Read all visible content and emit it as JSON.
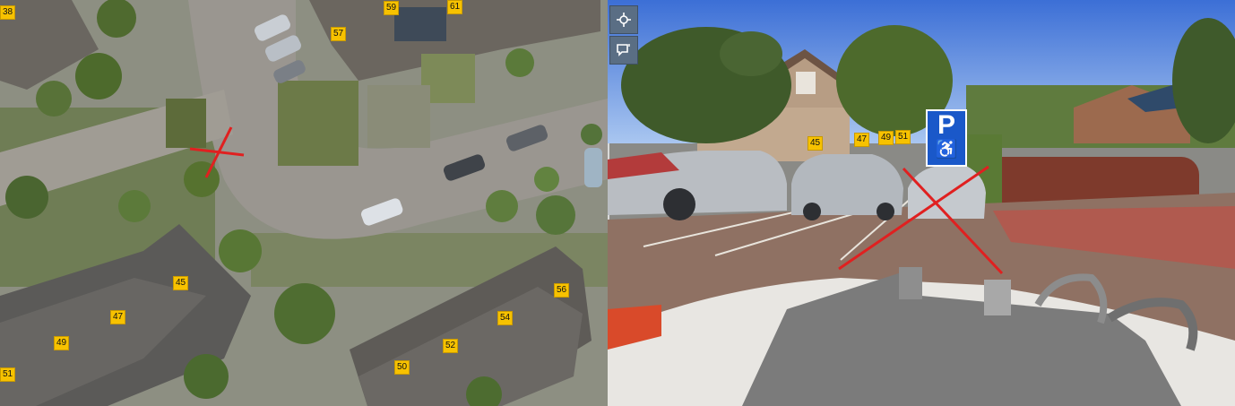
{
  "aerial_labels": [
    "38",
    "59",
    "61",
    "57",
    "45",
    "47",
    "49",
    "51",
    "56",
    "54",
    "52",
    "50"
  ],
  "street_labels": [
    "45",
    "47",
    "49",
    "51"
  ],
  "toolbar": {
    "buttons": [
      {
        "icon": "crosshair-move-icon"
      },
      {
        "icon": "comment-icon"
      }
    ]
  },
  "sign": {
    "letter": "P",
    "symbol": "♿"
  },
  "colors": {
    "label_bg": "#f7c200",
    "marker": "#e02020",
    "toolbar": "#5a6e84",
    "sign": "#1a58c9"
  }
}
